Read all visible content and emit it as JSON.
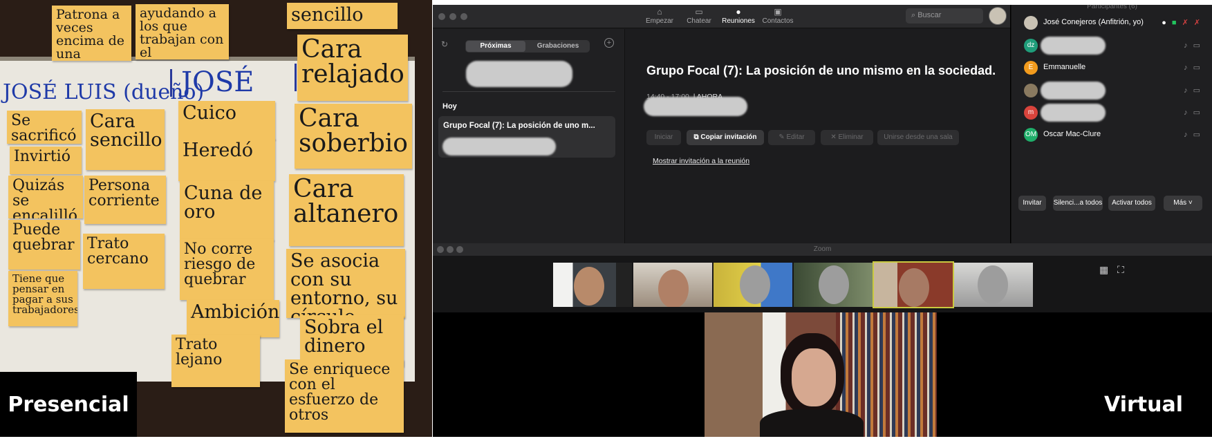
{
  "labels": {
    "presencial": "Presencial",
    "virtual": "Virtual"
  },
  "photo": {
    "top_notes": [
      "Patrona a veces encima de una",
      "ayudando a los que trabajan con el",
      "sencillo"
    ],
    "headers": {
      "col1": "JOSÉ LUIS (dueño)",
      "col2": "JOSÉ"
    },
    "notes": {
      "n1": "Se sacrificó",
      "n2": "Cara sencillo",
      "n3": "Invirtió",
      "n4": "Quizás se encalilló",
      "n5": "Persona corriente",
      "n6": "Puede quebrar",
      "n7": "Trato cercano",
      "n8": "Tiene que pensar en pagar a sus trabajadores/f.",
      "n9": "Cuico",
      "n10": "Heredó",
      "n11": "Cuna de oro",
      "n12": "No corre riesgo de quebrar",
      "n13": "Ambición",
      "n14": "Trato lejano",
      "n15": "Cara relajado",
      "n16": "Cara soberbio",
      "n17": "Cara altanero",
      "n18": "Se asocia con su entorno, su círculo",
      "n19": "Sobra el dinero",
      "n20": "Se enriquece con el esfuerzo de otros"
    }
  },
  "zoom": {
    "nav": [
      {
        "label": "Empezar",
        "icon": "home-icon",
        "glyph": "⌂"
      },
      {
        "label": "Chatear",
        "icon": "chat-icon",
        "glyph": "▭"
      },
      {
        "label": "Reuniones",
        "icon": "clock-icon",
        "glyph": "●"
      },
      {
        "label": "Contactos",
        "icon": "contacts-icon",
        "glyph": "▣"
      }
    ],
    "search_placeholder": "Buscar",
    "tabs": {
      "upcoming": "Próximas",
      "recorded": "Grabaciones"
    },
    "today_label": "Hoy",
    "meeting_card_title": "Grupo Focal (7): La posición de uno m...",
    "meeting": {
      "title": "Grupo Focal (7): La posición de uno mismo en la sociedad.",
      "time": "14:40 - 17:00",
      "status": "| AHORA",
      "buttons": {
        "start": "Iniciar",
        "copy": "Copiar invitación",
        "edit": "Editar",
        "delete": "Eliminar",
        "join_room": "Unirse desde una sala"
      },
      "show_invite": "Mostrar invitación a la reunión"
    },
    "participants": {
      "title": "Participantes (6)",
      "list": [
        {
          "name": "José Conejeros (Anfitrión, yo)",
          "initials": "",
          "color": "#c9c2b4"
        },
        {
          "name": "",
          "initials": "dz",
          "color": "#1f9d7a"
        },
        {
          "name": "Emmanuelle",
          "initials": "E",
          "color": "#f29b1d"
        },
        {
          "name": "",
          "initials": "",
          "color": "#8a7a60"
        },
        {
          "name": "",
          "initials": "m",
          "color": "#d9443c"
        },
        {
          "name": "Oscar Mac-Clure",
          "initials": "OM",
          "color": "#1fae6a"
        }
      ],
      "buttons": {
        "invite": "Invitar",
        "mute_all": "Silenci...a todos",
        "unmute_all": "Activar todos",
        "more": "Más"
      }
    },
    "gallery_title": "Zoom"
  }
}
